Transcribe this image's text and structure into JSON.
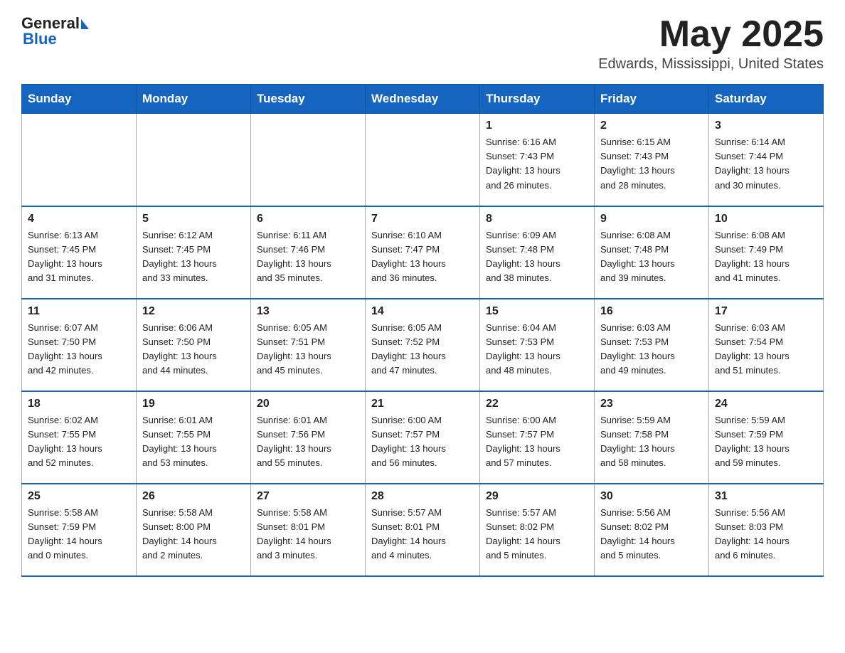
{
  "header": {
    "logo_general": "General",
    "logo_blue": "Blue",
    "month": "May 2025",
    "location": "Edwards, Mississippi, United States"
  },
  "weekdays": [
    "Sunday",
    "Monday",
    "Tuesday",
    "Wednesday",
    "Thursday",
    "Friday",
    "Saturday"
  ],
  "weeks": [
    [
      {
        "day": "",
        "info": ""
      },
      {
        "day": "",
        "info": ""
      },
      {
        "day": "",
        "info": ""
      },
      {
        "day": "",
        "info": ""
      },
      {
        "day": "1",
        "info": "Sunrise: 6:16 AM\nSunset: 7:43 PM\nDaylight: 13 hours\nand 26 minutes."
      },
      {
        "day": "2",
        "info": "Sunrise: 6:15 AM\nSunset: 7:43 PM\nDaylight: 13 hours\nand 28 minutes."
      },
      {
        "day": "3",
        "info": "Sunrise: 6:14 AM\nSunset: 7:44 PM\nDaylight: 13 hours\nand 30 minutes."
      }
    ],
    [
      {
        "day": "4",
        "info": "Sunrise: 6:13 AM\nSunset: 7:45 PM\nDaylight: 13 hours\nand 31 minutes."
      },
      {
        "day": "5",
        "info": "Sunrise: 6:12 AM\nSunset: 7:45 PM\nDaylight: 13 hours\nand 33 minutes."
      },
      {
        "day": "6",
        "info": "Sunrise: 6:11 AM\nSunset: 7:46 PM\nDaylight: 13 hours\nand 35 minutes."
      },
      {
        "day": "7",
        "info": "Sunrise: 6:10 AM\nSunset: 7:47 PM\nDaylight: 13 hours\nand 36 minutes."
      },
      {
        "day": "8",
        "info": "Sunrise: 6:09 AM\nSunset: 7:48 PM\nDaylight: 13 hours\nand 38 minutes."
      },
      {
        "day": "9",
        "info": "Sunrise: 6:08 AM\nSunset: 7:48 PM\nDaylight: 13 hours\nand 39 minutes."
      },
      {
        "day": "10",
        "info": "Sunrise: 6:08 AM\nSunset: 7:49 PM\nDaylight: 13 hours\nand 41 minutes."
      }
    ],
    [
      {
        "day": "11",
        "info": "Sunrise: 6:07 AM\nSunset: 7:50 PM\nDaylight: 13 hours\nand 42 minutes."
      },
      {
        "day": "12",
        "info": "Sunrise: 6:06 AM\nSunset: 7:50 PM\nDaylight: 13 hours\nand 44 minutes."
      },
      {
        "day": "13",
        "info": "Sunrise: 6:05 AM\nSunset: 7:51 PM\nDaylight: 13 hours\nand 45 minutes."
      },
      {
        "day": "14",
        "info": "Sunrise: 6:05 AM\nSunset: 7:52 PM\nDaylight: 13 hours\nand 47 minutes."
      },
      {
        "day": "15",
        "info": "Sunrise: 6:04 AM\nSunset: 7:53 PM\nDaylight: 13 hours\nand 48 minutes."
      },
      {
        "day": "16",
        "info": "Sunrise: 6:03 AM\nSunset: 7:53 PM\nDaylight: 13 hours\nand 49 minutes."
      },
      {
        "day": "17",
        "info": "Sunrise: 6:03 AM\nSunset: 7:54 PM\nDaylight: 13 hours\nand 51 minutes."
      }
    ],
    [
      {
        "day": "18",
        "info": "Sunrise: 6:02 AM\nSunset: 7:55 PM\nDaylight: 13 hours\nand 52 minutes."
      },
      {
        "day": "19",
        "info": "Sunrise: 6:01 AM\nSunset: 7:55 PM\nDaylight: 13 hours\nand 53 minutes."
      },
      {
        "day": "20",
        "info": "Sunrise: 6:01 AM\nSunset: 7:56 PM\nDaylight: 13 hours\nand 55 minutes."
      },
      {
        "day": "21",
        "info": "Sunrise: 6:00 AM\nSunset: 7:57 PM\nDaylight: 13 hours\nand 56 minutes."
      },
      {
        "day": "22",
        "info": "Sunrise: 6:00 AM\nSunset: 7:57 PM\nDaylight: 13 hours\nand 57 minutes."
      },
      {
        "day": "23",
        "info": "Sunrise: 5:59 AM\nSunset: 7:58 PM\nDaylight: 13 hours\nand 58 minutes."
      },
      {
        "day": "24",
        "info": "Sunrise: 5:59 AM\nSunset: 7:59 PM\nDaylight: 13 hours\nand 59 minutes."
      }
    ],
    [
      {
        "day": "25",
        "info": "Sunrise: 5:58 AM\nSunset: 7:59 PM\nDaylight: 14 hours\nand 0 minutes."
      },
      {
        "day": "26",
        "info": "Sunrise: 5:58 AM\nSunset: 8:00 PM\nDaylight: 14 hours\nand 2 minutes."
      },
      {
        "day": "27",
        "info": "Sunrise: 5:58 AM\nSunset: 8:01 PM\nDaylight: 14 hours\nand 3 minutes."
      },
      {
        "day": "28",
        "info": "Sunrise: 5:57 AM\nSunset: 8:01 PM\nDaylight: 14 hours\nand 4 minutes."
      },
      {
        "day": "29",
        "info": "Sunrise: 5:57 AM\nSunset: 8:02 PM\nDaylight: 14 hours\nand 5 minutes."
      },
      {
        "day": "30",
        "info": "Sunrise: 5:56 AM\nSunset: 8:02 PM\nDaylight: 14 hours\nand 5 minutes."
      },
      {
        "day": "31",
        "info": "Sunrise: 5:56 AM\nSunset: 8:03 PM\nDaylight: 14 hours\nand 6 minutes."
      }
    ]
  ]
}
